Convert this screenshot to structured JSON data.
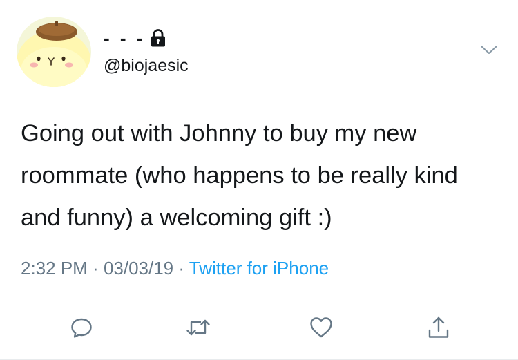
{
  "tweet": {
    "display_name": "- - -",
    "protected_icon": "lock-icon",
    "handle": "@biojaesic",
    "text": "Going out with Johnny to buy my new roommate (who happens to be really kind and funny) a welcoming gift :)",
    "time": "2:32 PM",
    "separator": " · ",
    "date": "03/03/19",
    "source": "Twitter for iPhone"
  },
  "actions": [
    {
      "name": "reply",
      "icon": "speech-bubble-icon"
    },
    {
      "name": "retweet",
      "icon": "retweet-icon"
    },
    {
      "name": "like",
      "icon": "heart-icon"
    },
    {
      "name": "share",
      "icon": "share-icon"
    }
  ],
  "colors": {
    "text": "#14171a",
    "muted": "#657786",
    "link": "#1da1f2",
    "divider": "#e1e8ed"
  }
}
